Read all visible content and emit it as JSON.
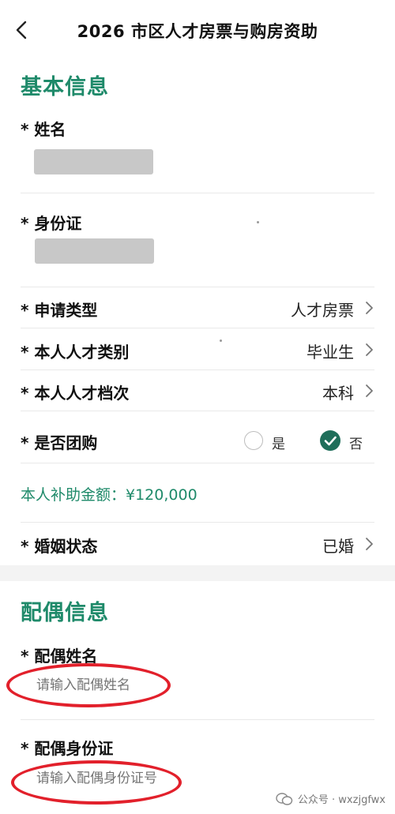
{
  "nav": {
    "title": "2026 市区人才房票与购房资助"
  },
  "basic": {
    "section_title": "基本信息",
    "name_label": "* 姓名",
    "id_label": "* 身份证",
    "apply_type": {
      "label": "* 申请类型",
      "value": "人才房票"
    },
    "talent_category": {
      "label": "* 本人人才类别",
      "value": "毕业生"
    },
    "talent_level": {
      "label": "* 本人人才档次",
      "value": "本科"
    },
    "group_buy": {
      "label": "* 是否团购",
      "option_yes": "是",
      "option_no": "否",
      "selected": "否"
    },
    "subsidy_text": "本人补助金额：¥120,000",
    "marital": {
      "label": "* 婚姻状态",
      "value": "已婚"
    }
  },
  "spouse": {
    "section_title": "配偶信息",
    "name_label": "* 配偶姓名",
    "name_placeholder": "请输入配偶姓名",
    "id_label": "* 配偶身份证",
    "id_placeholder": "请输入配偶身份证号"
  },
  "watermark": {
    "text": "公众号 · wxzjgfwx"
  },
  "colors": {
    "accent": "#1f8a6a",
    "check": "#1f6e5a",
    "annotation": "#e2202b"
  }
}
